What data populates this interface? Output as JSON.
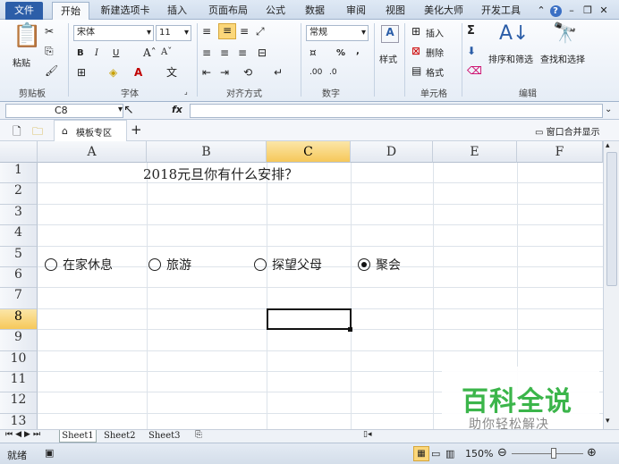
{
  "tabs": [
    "文件",
    "开始",
    "新建选项卡",
    "插入",
    "页面布局",
    "公式",
    "数据",
    "审阅",
    "视图",
    "美化大师",
    "开发工具"
  ],
  "ribbon": {
    "paste": "粘贴",
    "font_name": "宋体",
    "font_size": "11",
    "bold": "B",
    "italic": "I",
    "underline": "U",
    "number_format": "常规",
    "percent": "%",
    "comma": ",",
    "inc_dec": ".00",
    "dec_dec": ".0",
    "styles": "样式",
    "insert": "插入",
    "delete": "删除",
    "format": "格式",
    "sigma": "Σ",
    "sort_filter": "排序和筛选",
    "find_select": "查找和选择",
    "groups": [
      "剪贴板",
      "字体",
      "对齐方式",
      "数字",
      "单元格",
      "编辑"
    ]
  },
  "formula": {
    "cell_ref": "C8",
    "fx": "fx",
    "value": ""
  },
  "doc_tabs": {
    "template": "模板专区",
    "add": "+",
    "merge_window": "窗口合并显示"
  },
  "columns": [
    "A",
    "B",
    "C",
    "D",
    "E",
    "F"
  ],
  "rows": [
    "1",
    "2",
    "3",
    "4",
    "5",
    "6",
    "7",
    "8",
    "9",
    "10",
    "11",
    "12",
    "13"
  ],
  "selected_cell": "C8",
  "cells": {
    "title": "2018元旦你有什么安排？"
  },
  "options": [
    {
      "label": "在家休息",
      "checked": false
    },
    {
      "label": "旅游",
      "checked": false
    },
    {
      "label": "探望父母",
      "checked": false
    },
    {
      "label": "聚会",
      "checked": true
    }
  ],
  "sheets": [
    "Sheet1",
    "Sheet2",
    "Sheet3"
  ],
  "status": {
    "ready": "就绪",
    "zoom": "150%"
  },
  "watermark": {
    "title": "百科全说",
    "subtitle": "助你轻松解决"
  }
}
